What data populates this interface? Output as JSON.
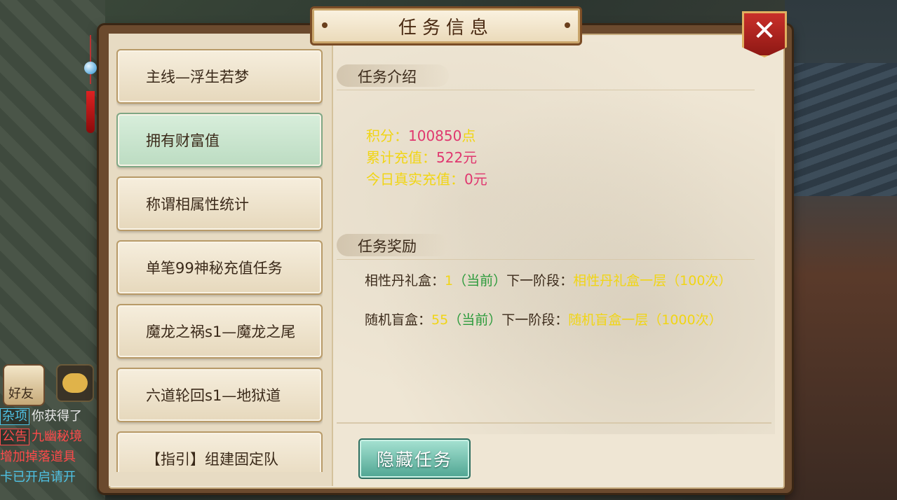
{
  "title": "任务信息",
  "close_icon": "close-x-icon",
  "quests": [
    {
      "label": "主线—浮生若梦",
      "active": false
    },
    {
      "label": "拥有财富值",
      "active": true
    },
    {
      "label": "称谓相属性统计",
      "active": false
    },
    {
      "label": "单笔99神秘充值任务",
      "active": false
    },
    {
      "label": "魔龙之祸s1—魔龙之尾",
      "active": false
    },
    {
      "label": "六道轮回s1—地狱道",
      "active": false
    },
    {
      "label": "【指引】组建固定队",
      "active": false
    }
  ],
  "intro": {
    "heading": "任务介绍",
    "points_label": "积分：",
    "points_value": "100850",
    "points_unit": "点",
    "recharge_label": "累计充值：",
    "recharge_value": "522元",
    "today_label": "今日真实充值：",
    "today_value": "0元"
  },
  "reward": {
    "heading": "任务奖励",
    "line1_label": "相性丹礼盒：",
    "line1_count": "1",
    "line1_current": "（当前）",
    "line1_next_label": "下一阶段：",
    "line1_next": "相性丹礼盒一层（100次）",
    "line2_label": "随机盲盒：",
    "line2_count": "55",
    "line2_current": "（当前）",
    "line2_next_label": "下一阶段：",
    "line2_next": "随机盲盒一层（1000次）"
  },
  "hide_button": "隐藏任务",
  "chat": {
    "friend_label": "好友",
    "rows": [
      {
        "tag": "杂项",
        "text": "你获得了"
      },
      {
        "tag": "公告",
        "text": "九幽秘境"
      },
      {
        "tag": "",
        "text": "增加掉落道具"
      },
      {
        "tag": "",
        "text": "卡已开启请开"
      }
    ]
  },
  "colors": {
    "accent_yellow": "#f1d514",
    "accent_pink": "#e0376f",
    "accent_green": "#2a9a3a",
    "button_teal": "#4fa592",
    "close_red": "#c9302a"
  }
}
